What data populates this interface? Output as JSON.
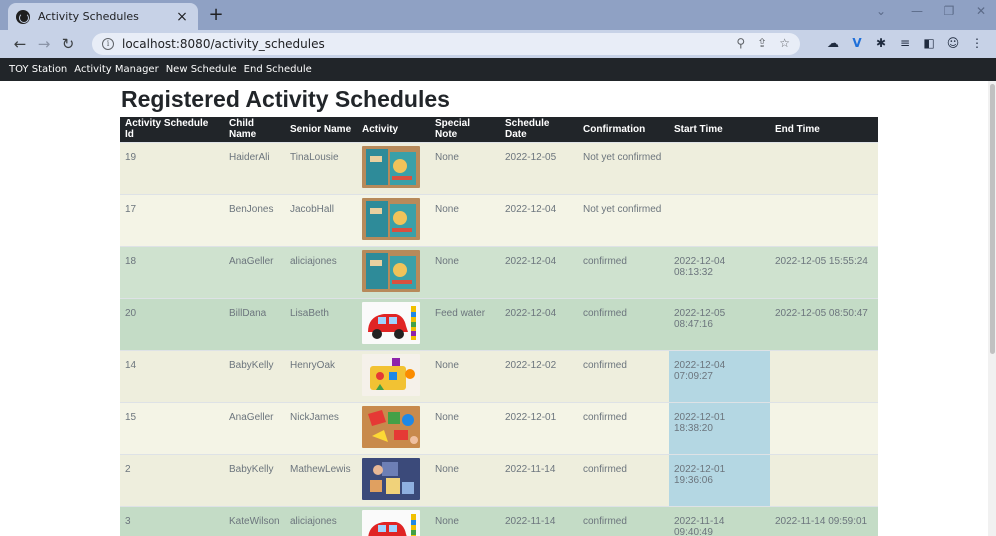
{
  "browser": {
    "tab_title": "Activity Schedules",
    "tab_close": "×",
    "new_tab": "+",
    "url": "localhost:8080/activity_schedules"
  },
  "navbar": {
    "brand": "TOY Station",
    "items": [
      "Activity Manager",
      "New Schedule",
      "End Schedule"
    ]
  },
  "page": {
    "title": "Registered Activity Schedules"
  },
  "table": {
    "headers": [
      "Activity Schedule Id",
      "Child Name",
      "Senior Name",
      "Activity",
      "Special Note",
      "Schedule Date",
      "Confirmation",
      "Start Time",
      "End Time"
    ],
    "rows": [
      {
        "id": "19",
        "child": "HaiderAli",
        "senior": "TinaLousie",
        "activity_image": "book-toy",
        "note": "None",
        "date": "2022-12-05",
        "confirmation": "Not yet confirmed",
        "start": "",
        "end": "",
        "status": "warn"
      },
      {
        "id": "17",
        "child": "BenJones",
        "senior": "JacobHall",
        "activity_image": "book-toy",
        "note": "None",
        "date": "2022-12-04",
        "confirmation": "Not yet confirmed",
        "start": "",
        "end": "",
        "status": "warn"
      },
      {
        "id": "18",
        "child": "AnaGeller",
        "senior": "aliciajones",
        "activity_image": "book-toy",
        "note": "None",
        "date": "2022-12-04",
        "confirmation": "confirmed",
        "start": "2022-12-04 08:13:32",
        "end": "2022-12-05 15:55:24",
        "status": "ok"
      },
      {
        "id": "20",
        "child": "BillDana",
        "senior": "LisaBeth",
        "activity_image": "car-toy",
        "note": "Feed water",
        "date": "2022-12-04",
        "confirmation": "confirmed",
        "start": "2022-12-05 08:47:16",
        "end": "2022-12-05 08:50:47",
        "status": "ok"
      },
      {
        "id": "14",
        "child": "BabyKelly",
        "senior": "HenryOak",
        "activity_image": "shape-sorter-toy",
        "note": "None",
        "date": "2022-12-02",
        "confirmation": "confirmed",
        "start": "2022-12-04 07:09:27",
        "end": "",
        "status": "info"
      },
      {
        "id": "15",
        "child": "AnaGeller",
        "senior": "NickJames",
        "activity_image": "puzzle-toy",
        "note": "None",
        "date": "2022-12-01",
        "confirmation": "confirmed",
        "start": "2022-12-01 18:38:20",
        "end": "",
        "status": "info"
      },
      {
        "id": "2",
        "child": "BabyKelly",
        "senior": "MathewLewis",
        "activity_image": "blocks-toy",
        "note": "None",
        "date": "2022-11-14",
        "confirmation": "confirmed",
        "start": "2022-12-01 19:36:06",
        "end": "",
        "status": "info"
      },
      {
        "id": "3",
        "child": "KateWilson",
        "senior": "aliciajones",
        "activity_image": "car-toy",
        "note": "None",
        "date": "2022-11-14",
        "confirmation": "confirmed",
        "start": "2022-11-14 09:40:49",
        "end": "2022-11-14 09:59:01",
        "status": "ok"
      }
    ]
  }
}
